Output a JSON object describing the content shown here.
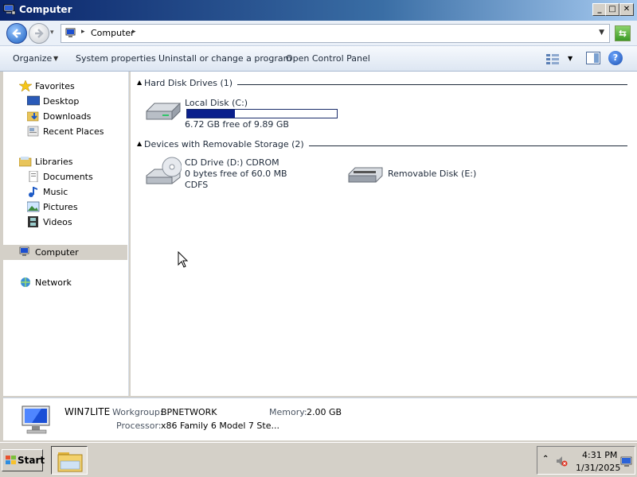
{
  "window": {
    "title": "Computer"
  },
  "address": {
    "path": "Computer"
  },
  "toolbar": {
    "organize": "Organize",
    "system_properties": "System properties",
    "uninstall": "Uninstall or change a program",
    "control_panel": "Open Control Panel"
  },
  "nav": {
    "favorites": "Favorites",
    "desktop": "Desktop",
    "downloads": "Downloads",
    "recent": "Recent Places",
    "libraries": "Libraries",
    "documents": "Documents",
    "music": "Music",
    "pictures": "Pictures",
    "videos": "Videos",
    "computer": "Computer",
    "network": "Network"
  },
  "groups": {
    "hdd": "Hard Disk Drives (1)",
    "removable": "Devices with Removable Storage (2)"
  },
  "drives": {
    "c": {
      "name": "Local Disk (C:)",
      "free": "6.72 GB free of 9.89 GB",
      "used_fraction": 0.32
    },
    "d": {
      "name": "CD Drive (D:) CDROM",
      "free": "0 bytes free of 60.0 MB",
      "fs": "CDFS"
    },
    "e": {
      "name": "Removable Disk (E:)"
    }
  },
  "details": {
    "name": "WIN7LITE",
    "workgroup_label": "Workgroup:",
    "workgroup": "BPNETWORK",
    "memory_label": "Memory:",
    "memory": "2.00 GB",
    "processor_label": "Processor:",
    "processor": "x86 Family 6 Model 7 Ste..."
  },
  "taskbar": {
    "start": "Start",
    "time": "4:31 PM",
    "date": "1/31/2025"
  },
  "colors": {
    "usage_bar": "#0a1f8c",
    "title_gradient_start": "#0a246a"
  }
}
